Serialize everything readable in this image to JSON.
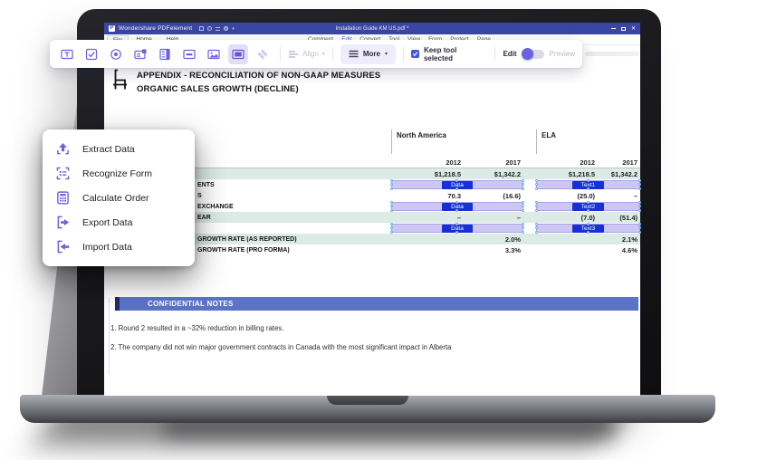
{
  "colors": {
    "accent_purple": "#6b62dd",
    "titlebar_indigo": "#3a46a3",
    "active_tab_blue": "#4a5fd6",
    "form_field_fill": "#cdc7f3",
    "form_field_tag_blue": "#1730d4",
    "table_row_teal": "#dcebe6",
    "notes_banner_blue": "#5b74c6",
    "keep_tool_checkbox_blue": "#4356df"
  },
  "window": {
    "app_title": "Wondershare PDFelement",
    "doc_title": "Installation Guide KM US.pdf *",
    "menus": [
      "File",
      "Home",
      "Help"
    ],
    "tabs": [
      {
        "label": "Comment",
        "active": false
      },
      {
        "label": "Edit",
        "active": true
      },
      {
        "label": "Convert",
        "active": false
      },
      {
        "label": "Tool",
        "active": false
      },
      {
        "label": "View",
        "active": false
      },
      {
        "label": "Form",
        "active": false
      },
      {
        "label": "Protect",
        "active": false
      },
      {
        "label": "Page",
        "active": false
      }
    ],
    "quick_access_icons": [
      "open-icon",
      "settings-icon",
      "print-icon",
      "share-icon",
      "dropdown-icon"
    ],
    "window_control_icons": [
      "minimize-icon",
      "maximize-icon",
      "close-icon"
    ]
  },
  "toolbar": {
    "tool_icons": [
      "text-field-icon",
      "checkbox-field-icon",
      "radio-button-field-icon",
      "combobox-field-icon",
      "listbox-field-icon",
      "button-field-icon",
      "image-field-icon",
      "signature-field-icon",
      "eraser-icon"
    ],
    "selected_tool": "signature-field-icon",
    "align_label": "Align",
    "more_label": "More",
    "keep_tool_label": "Keep tool selected",
    "keep_tool_checked": true,
    "edit_label": "Edit",
    "preview_label": "Preview",
    "edit_mode_on": true
  },
  "context_menu": {
    "items": [
      {
        "icon": "extract-data-icon",
        "label": "Extract Data"
      },
      {
        "icon": "recognize-form-icon",
        "label": "Recognize Form"
      },
      {
        "icon": "calculate-order-icon",
        "label": "Calculate Order"
      },
      {
        "icon": "export-data-icon",
        "label": "Export Data"
      },
      {
        "icon": "import-data-icon",
        "label": "Import Data"
      }
    ]
  },
  "document": {
    "heading_line1": "APPENDIX - RECONCILIATION OF NON-GAAP MEASURES",
    "heading_line2": "ORGANIC SALES GROWTH (DECLINE)",
    "table": {
      "group_headers": [
        "North America",
        "ELA"
      ],
      "year_headers": [
        "2012",
        "2017",
        "2012",
        "2017"
      ],
      "rows": [
        {
          "style": "teal",
          "cells": [
            "$1,218.5",
            "$1,342.2",
            "$1,218.5",
            "$1,342.2"
          ]
        },
        {
          "style": "fields",
          "label": "ENTS",
          "na_tag": "Data",
          "ela_tag": "Text1"
        },
        {
          "style": "white",
          "label": "S",
          "cells": [
            "70.3",
            "(16.6)",
            "(25.0)",
            "–"
          ]
        },
        {
          "style": "fields",
          "label": "EXCHANGE",
          "na_tag": "Data",
          "ela_tag": "Text2"
        },
        {
          "style": "teal",
          "label": "EAR",
          "cells": [
            "–",
            "–",
            "(7.0)",
            "(51.4)"
          ]
        },
        {
          "style": "fields",
          "label": "",
          "na_tag": "Data",
          "ela_tag": "Text3"
        },
        {
          "style": "teal",
          "label": "GROWTH RATE (AS REPORTED)",
          "cells": [
            "",
            "2.0%",
            "",
            "2.1%"
          ]
        },
        {
          "style": "white",
          "label": "GROWTH RATE (PRO FORMA)",
          "cells": [
            "",
            "3.3%",
            "",
            "4.6%"
          ]
        }
      ]
    },
    "notes": {
      "banner_label": "CONFIDENTIAL NOTES",
      "items": [
        "1. Round 2 resulted in a ~32% reduction in billing rates.",
        "2. The company did not win major government contracts in Canada with the most significant impact in Alberta"
      ]
    }
  }
}
